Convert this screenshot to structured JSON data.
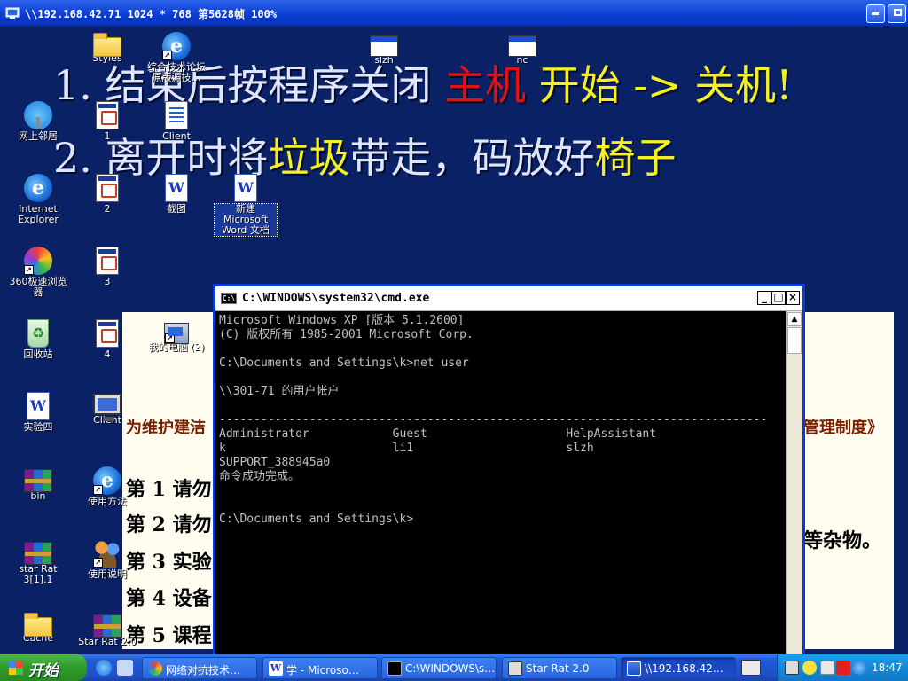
{
  "window": {
    "title": "\\\\192.168.42.71 1024 * 768 第5628帧 100%",
    "minimize_icon": "minimize-icon",
    "restore_icon": "restore-icon"
  },
  "wallpaper": {
    "line1_prefix": "1. 结束后按程序关闭 ",
    "line1_red": "主机",
    "line1_yellow": " 开始 -> 关机!",
    "line2_prefix": "2. 离开时将",
    "line2_y1": "垃圾",
    "line2_mid": "带走，码放好",
    "line2_y2": "椅子"
  },
  "document_behind": {
    "heading_left": "为维护建洁",
    "heading_right": "管理制度》",
    "rules": [
      "第 1 请勿",
      "第 2 请勿",
      "第 3 实验",
      "第 4 设备",
      "第 5 课程"
    ],
    "tail_right": "等杂物。"
  },
  "desktop_icons": [
    {
      "label": "Styles",
      "icon": "folder-icon"
    },
    {
      "label": "综合技术论坛 原版源技…",
      "icon": "ie-shortcut-icon"
    },
    {
      "label": "slzh",
      "icon": "app-window-icon"
    },
    {
      "label": "nc",
      "icon": "app-window-icon"
    },
    {
      "label": "网上邻居",
      "icon": "network-places-icon"
    },
    {
      "label": "1",
      "icon": "exe-icon"
    },
    {
      "label": "Client",
      "icon": "client-program-icon"
    },
    {
      "label": "Internet Explorer",
      "icon": "internet-explorer-icon"
    },
    {
      "label": "2",
      "icon": "exe-icon"
    },
    {
      "label": "截图",
      "icon": "word-doc-icon"
    },
    {
      "label": "新建 Microsoft Word 文档",
      "icon": "word-doc-icon"
    },
    {
      "label": "360极速浏览器",
      "icon": "browser-360-icon"
    },
    {
      "label": "3",
      "icon": "exe-icon"
    },
    {
      "label": "回收站",
      "icon": "recycle-bin-icon"
    },
    {
      "label": "4",
      "icon": "exe-icon"
    },
    {
      "label": "我的电脑 (2)",
      "icon": "my-computer-icon"
    },
    {
      "label": "实验四",
      "icon": "word-doc-icon"
    },
    {
      "label": "Client",
      "icon": "monitor-icon"
    },
    {
      "label": "bin",
      "icon": "winrar-archive-icon"
    },
    {
      "label": "使用方法",
      "icon": "ie-shortcut-icon"
    },
    {
      "label": "star Rat 3[1].1",
      "icon": "winrar-archive-icon"
    },
    {
      "label": "使用说明",
      "icon": "users-shortcut-icon"
    },
    {
      "label": "Cache",
      "icon": "folder-icon"
    },
    {
      "label": "Star Rat 2.0",
      "icon": "winrar-archive-icon"
    }
  ],
  "cmd": {
    "title": "C:\\WINDOWS\\system32\\cmd.exe",
    "icon_text": "C:\\",
    "buttons": {
      "minimize": "_",
      "maximize": "□",
      "close": "×"
    },
    "lines": [
      "Microsoft Windows XP [版本 5.1.2600]",
      "(C) 版权所有 1985-2001 Microsoft Corp.",
      "",
      "C:\\Documents and Settings\\k>net user",
      "",
      "\\\\301-71 的用户帐户",
      "",
      "-------------------------------------------------------------------------------",
      "Administrator            Guest                    HelpAssistant",
      "k                        li1                      slzh",
      "SUPPORT_388945a0",
      "命令成功完成。",
      "",
      "",
      "C:\\Documents and Settings\\k>"
    ]
  },
  "taskbar": {
    "start_label": "开始",
    "buttons": [
      "网络对抗技术…",
      "学 - Microso…",
      "C:\\WINDOWS\\s…",
      "Star Rat 2.0",
      "\\\\192.168.42…"
    ],
    "clock": "18:47"
  }
}
